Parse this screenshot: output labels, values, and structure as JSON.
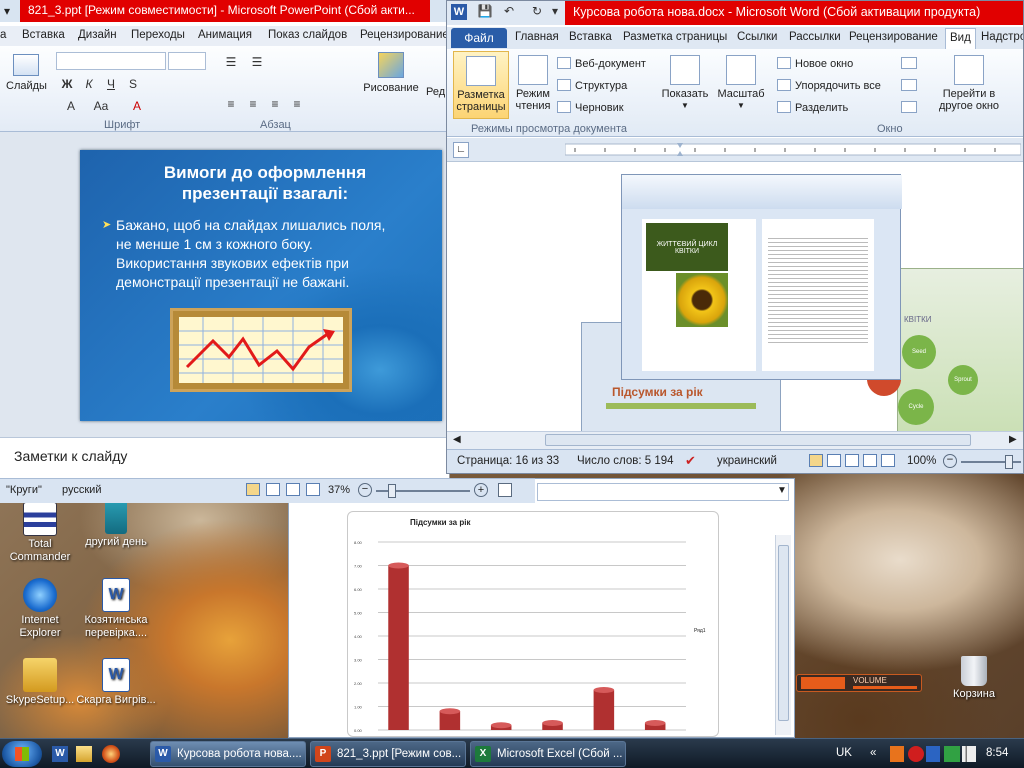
{
  "desktop": {
    "icons": [
      {
        "label": "Total Commander"
      },
      {
        "label": "другий день"
      },
      {
        "label": "Internet Explorer"
      },
      {
        "label": "Козятинська перевірка...."
      },
      {
        "label": "SkypeSetup..."
      },
      {
        "label": "Скарга Вигрів..."
      },
      {
        "label": "Корзина"
      }
    ],
    "volume_label": "VOLUME"
  },
  "powerpoint": {
    "title": "821_3.ppt [Режим совместимости]  -  Microsoft PowerPoint (Сбой акти...",
    "tabs": [
      "а",
      "Вставка",
      "Дизайн",
      "Переходы",
      "Анимация",
      "Показ слайдов",
      "Рецензирование"
    ],
    "ribbon": {
      "slides_label": "Слайды",
      "font_group": "Шрифт",
      "paragraph_group": "Абзац",
      "drawing_label": "Рисование",
      "edit_partial": "Ред"
    },
    "slide": {
      "title": "Вимоги до оформлення презентації взагалі:",
      "bullet": "Бажано, щоб на слайдах лишались поля, не менше 1 см з кожного боку. Використання звукових ефектів при демонстрації презентації не бажані."
    },
    "notes_placeholder": "Заметки к слайду",
    "status": {
      "theme": "\"Круги\"",
      "language": "русский",
      "zoom": "37%"
    }
  },
  "excel": {
    "chart": {
      "title": "Підсумки за рік",
      "legend": "Ряд1"
    }
  },
  "word": {
    "title": "Курсова робота нова.docx  -  Microsoft Word (Сбой активации продукта)",
    "file_tab": "Файл",
    "tabs": [
      "Главная",
      "Вставка",
      "Разметка страницы",
      "Ссылки",
      "Рассылки",
      "Рецензирование",
      "Вид",
      "Надстро"
    ],
    "ribbon": {
      "page_layout": "Разметка страницы",
      "reading_mode": "Режим чтения",
      "web_doc": "Веб-документ",
      "outline": "Структура",
      "draft": "Черновик",
      "view_group": "Режимы просмотра документа",
      "show": "Показать",
      "zoom": "Масштаб",
      "new_window": "Новое окно",
      "arrange_all": "Упорядочить все",
      "split": "Разделить",
      "switch_window": "Перейти в другое окно",
      "window_group": "Окно"
    },
    "document": {
      "embed_heading": "Підсумки за рік",
      "embed_badge": "ЖИТТЄВИЙ ЦИКЛ КВІТКИ",
      "embed_right": "КВІТКИ",
      "cycle_labels": [
        "Seed",
        "Sprout",
        "Cycle",
        "Flower"
      ]
    },
    "status": {
      "page": "Страница: 16 из 33",
      "words": "Число слов: 5 194",
      "language": "украинский",
      "zoom": "100%"
    }
  },
  "taskbar": {
    "buttons": [
      {
        "label": "Курсова робота нова...."
      },
      {
        "label": "821_3.ppt [Режим сов..."
      },
      {
        "label": "Microsoft Excel (Сбой ..."
      }
    ],
    "lang": "UK",
    "time": "8:54"
  },
  "colors": {
    "error_title_bar": "#e10000",
    "slide_blue": "#1e63ad",
    "word_file_tab": "#2a5da8",
    "chart_bar": "#b03030"
  },
  "chart_data": {
    "type": "bar",
    "title": "Підсумки за рік",
    "categories": [
      "1",
      "2",
      "3",
      "4",
      "5",
      "6"
    ],
    "series": [
      {
        "name": "Ряд1",
        "values": [
          7.0,
          0.8,
          0.2,
          0.3,
          1.7,
          0.3
        ]
      }
    ],
    "ylim": [
      0,
      8
    ],
    "grid": true,
    "legend": "right"
  }
}
